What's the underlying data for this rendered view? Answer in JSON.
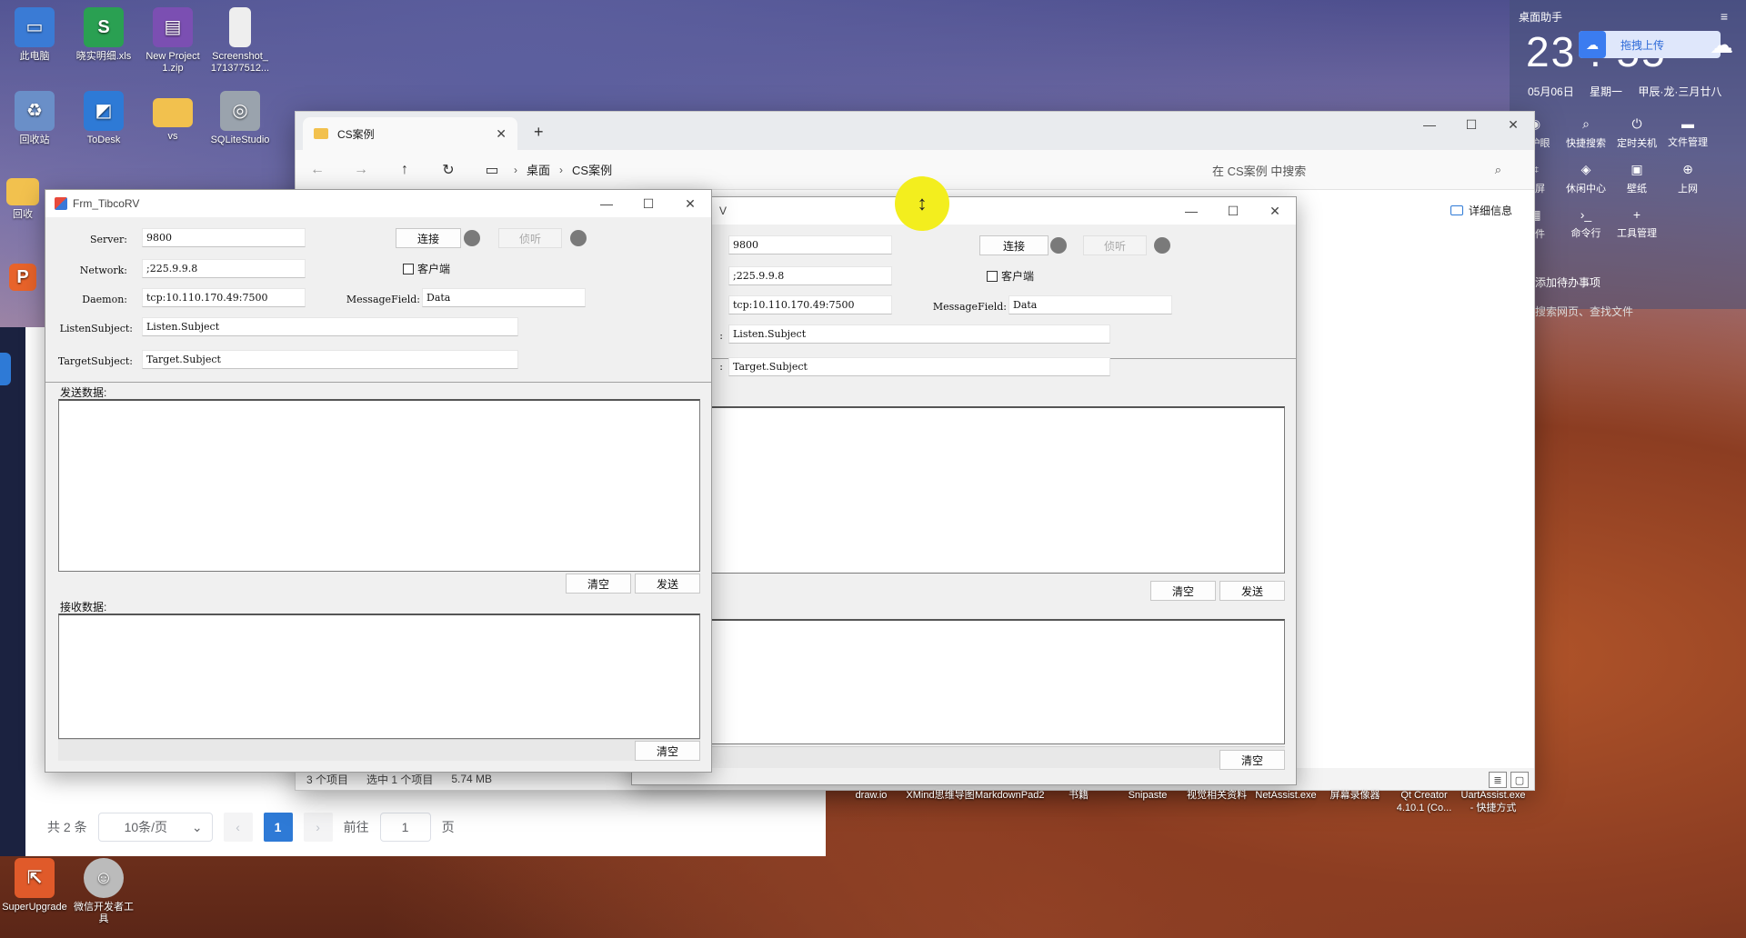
{
  "desktop_icons_top": [
    {
      "label": "此电脑",
      "color": "#3a7bd5",
      "glyph": "▭"
    },
    {
      "label": "晓实明细.xls",
      "color": "#2aa052",
      "glyph": "S"
    },
    {
      "label": "New Project 1.zip",
      "color": "#7b4fb2",
      "glyph": "▤"
    },
    {
      "label": "Screenshot_ 171377512...",
      "color": "#eeeeee",
      "glyph": ""
    },
    {
      "label": "回收站",
      "color": "#6a8fc8",
      "glyph": "♻"
    },
    {
      "label": "ToDesk",
      "color": "#2e7ad6",
      "glyph": "◩"
    },
    {
      "label": "vs",
      "color": "#f2c14e",
      "glyph": ""
    },
    {
      "label": "SQLiteStudio",
      "color": "#9aa3ad",
      "glyph": "◎"
    }
  ],
  "desktop_icons_left_partial": [
    {
      "label": "回收",
      "color": "#f2c14e"
    },
    {
      "label": "",
      "color": "#e8632a"
    }
  ],
  "desktop_icons_bottom": [
    {
      "label": "SuperUpgrade",
      "color": "#e05a2a",
      "glyph": "⇱"
    },
    {
      "label": "微信开发者工具",
      "color": "#bbbbbb",
      "glyph": "☺"
    }
  ],
  "taskbar_labels": [
    "draw.io",
    "XMind思维导图",
    "MarkdownPad2",
    "书籍",
    "Snipaste",
    "视觉相关资料",
    "NetAssist.exe",
    "屏幕录像器",
    "Qt Creator 4.10.1 (Co...",
    "UartAssist.exe - 快捷方式"
  ],
  "widget": {
    "title": "桌面助手",
    "time": "23 : 55",
    "upload_label": "拖拽上传",
    "date": "05月06日",
    "weekday": "星期一",
    "lunar": "甲辰·龙·三月廿八",
    "tools_row1": [
      "康护眼",
      "快捷搜索",
      "定时关机",
      "文件管理"
    ],
    "tools_row2": [
      "截屏",
      "休闲中心",
      "壁纸",
      "上网"
    ],
    "tools_row3": [
      "软件",
      "命令行",
      "工具管理"
    ],
    "todo": "添加待办事项",
    "search_hint": "搜索网页、查找文件"
  },
  "explorer": {
    "tab_title": "CS案例",
    "breadcrumb": [
      "桌面",
      "CS案例"
    ],
    "search_placeholder": "在 CS案例 中搜索",
    "details_label": "详细信息",
    "status": {
      "items": "3 个项目",
      "selected": "选中 1 个项目",
      "size": "5.74 MB"
    }
  },
  "webpage": {
    "total": "共 2 条",
    "page_size": "10条/页",
    "current_page": "1",
    "goto_label": "前往",
    "goto_value": "1",
    "page_suffix": "页"
  },
  "form": {
    "title": "Frm_TibcoRV",
    "server_label": "Server:",
    "server": "9800",
    "network_label": "Network:",
    "network": ";225.9.9.8",
    "daemon_label": "Daemon:",
    "daemon": "tcp:10.110.170.49:7500",
    "messagefield_label": "MessageField:",
    "messagefield": "Data",
    "listen_label": "ListenSubject:",
    "listen": "Listen.Subject",
    "target_label": "TargetSubject:",
    "target": "Target.Subject",
    "connect_btn": "连接",
    "listen_btn": "侦听",
    "client_chk": "客户端",
    "send_group": "发送数据:",
    "recv_group": "接收数据:",
    "clear_btn": "清空",
    "send_btn": "发送"
  },
  "form2": {
    "title_fragment": "V",
    "label_fragment": ":"
  },
  "colors": {
    "accent": "#2e7ad6",
    "led": "#7a7a7a",
    "highlight": "#f3ee1e"
  }
}
